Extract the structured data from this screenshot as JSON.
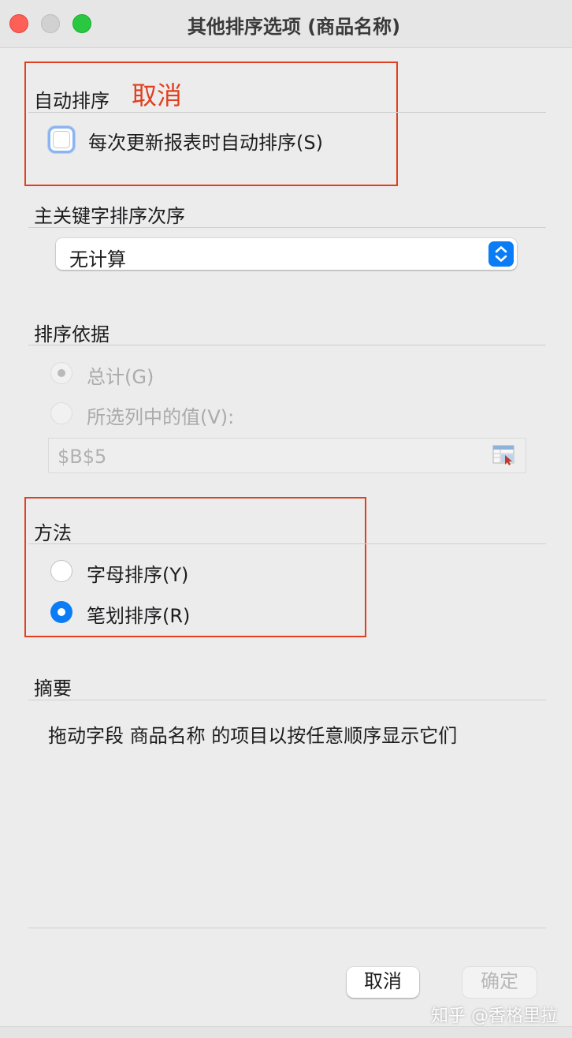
{
  "window": {
    "title": "其他排序选项 (商品名称)"
  },
  "auto_sort": {
    "heading": "自动排序",
    "annotation": "取消",
    "checkbox_label": "每次更新报表时自动排序(S)",
    "checked": false
  },
  "key_order": {
    "heading": "主关键字排序次序",
    "select_value": "无计算"
  },
  "sort_by": {
    "heading": "排序依据",
    "option_total": "总计(G)",
    "option_column": "所选列中的值(V):",
    "reference_value": "$B$5"
  },
  "method": {
    "heading": "方法",
    "option_alpha": "字母排序(Y)",
    "option_stroke": "笔划排序(R)",
    "selected": "option_stroke"
  },
  "summary": {
    "heading": "摘要",
    "text": "拖动字段 商品名称 的项目以按任意顺序显示它们"
  },
  "buttons": {
    "cancel": "取消",
    "ok": "确定"
  },
  "watermark": "知乎 @香格里拉",
  "colors": {
    "accent": "#0a7cf5",
    "annotation": "#e0401f"
  }
}
